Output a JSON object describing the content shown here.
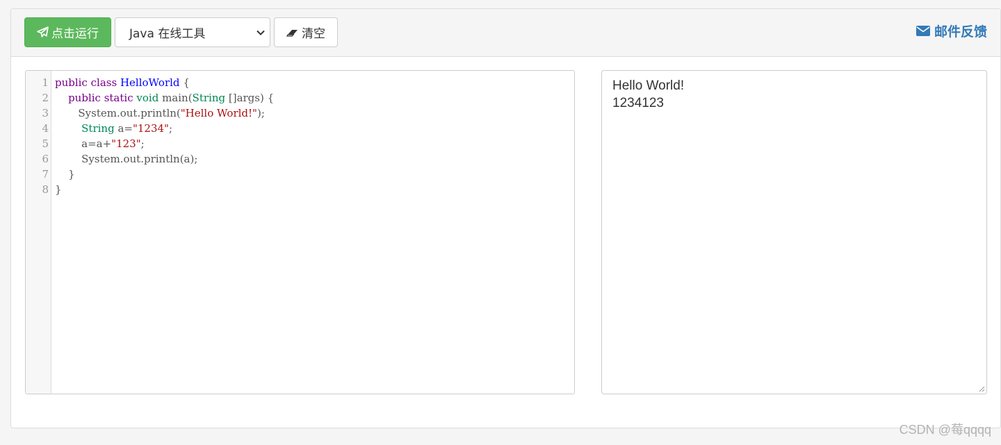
{
  "toolbar": {
    "run_label": "点击运行",
    "language_selected": "Java 在线工具",
    "clear_label": "清空",
    "feedback_label": "邮件反馈"
  },
  "editor": {
    "line_numbers": [
      "1",
      "2",
      "3",
      "4",
      "5",
      "6",
      "7",
      "8"
    ]
  },
  "output": {
    "lines": [
      "Hello World!",
      "1234123"
    ]
  },
  "watermark": "CSDN @莓qqqq",
  "colors": {
    "run_button": "#5cb85c",
    "link": "#337ab7",
    "keyword": "#770088",
    "definition": "#0000ff",
    "type": "#008855",
    "string": "#aa1111"
  }
}
